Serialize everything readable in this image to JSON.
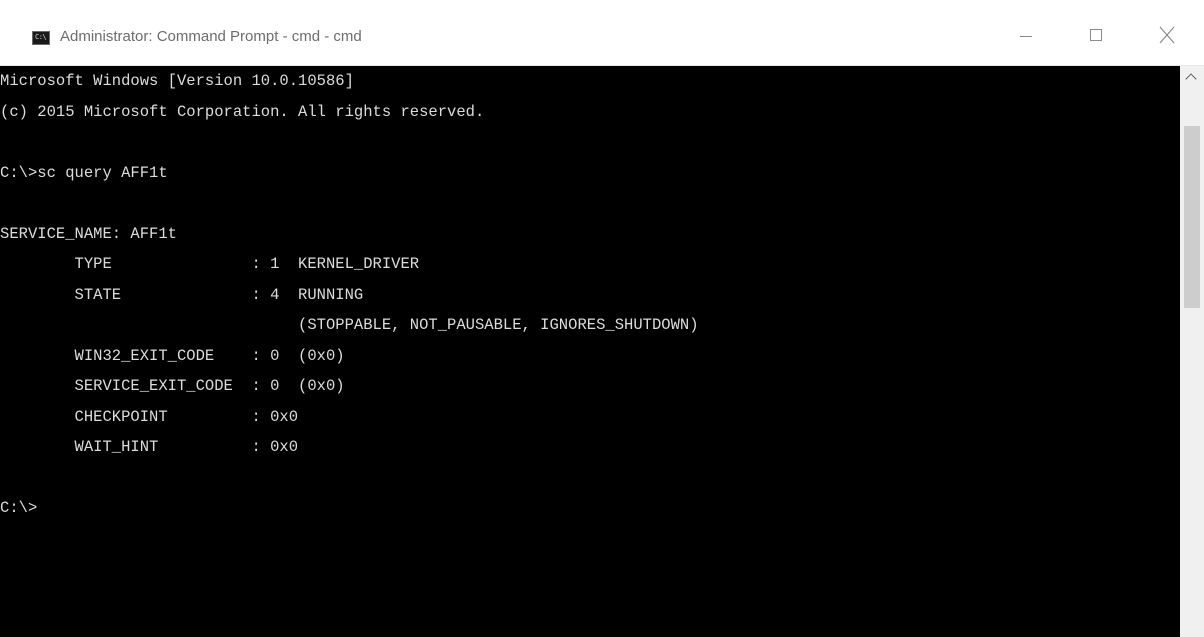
{
  "window": {
    "title": "Administrator: Command Prompt - cmd - cmd",
    "icon_label": "C:\\",
    "icon": "cmd-app-icon",
    "controls": [
      "minimize-icon",
      "maximize-icon",
      "close-icon"
    ]
  },
  "console": {
    "background": "#000000",
    "foreground": "#dcdcdc",
    "lines": [
      "Microsoft Windows [Version 10.0.10586]",
      "(c) 2015 Microsoft Corporation. All rights reserved.",
      "",
      "C:\\>sc query AFF1t",
      "",
      "SERVICE_NAME: AFF1t",
      "        TYPE               : 1  KERNEL_DRIVER",
      "        STATE              : 4  RUNNING",
      "                                (STOPPABLE, NOT_PAUSABLE, IGNORES_SHUTDOWN)",
      "        WIN32_EXIT_CODE    : 0  (0x0)",
      "        SERVICE_EXIT_CODE  : 0  (0x0)",
      "        CHECKPOINT         : 0x0",
      "        WAIT_HINT          : 0x0",
      "",
      "C:\\>"
    ]
  },
  "scrollbar": {
    "up_icon": "chevron-up-icon"
  }
}
